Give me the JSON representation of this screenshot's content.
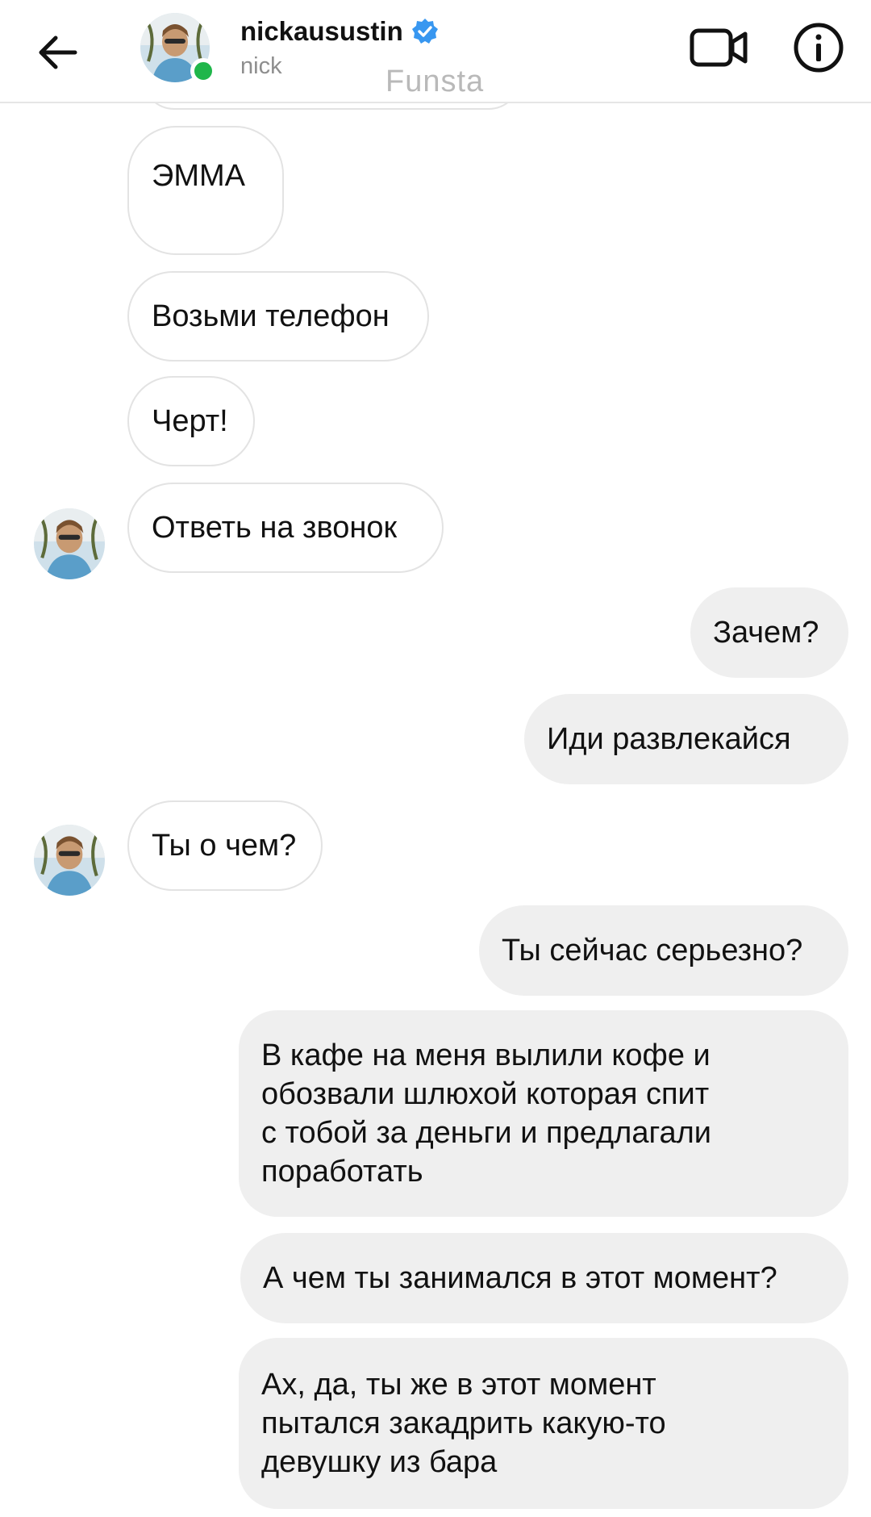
{
  "header": {
    "username": "nickausustin",
    "subname": "nick",
    "watermark": "Funsta",
    "icons": {
      "back": "back-arrow-icon",
      "verified": "verified-badge-icon",
      "video": "video-call-icon",
      "info": "info-icon"
    },
    "online_color": "#1fb64a",
    "verified_color": "#3897f0"
  },
  "messages": [
    {
      "id": "m1",
      "from": "them",
      "text": "ЭММА"
    },
    {
      "id": "m2",
      "from": "them",
      "text": "Возьми телефон"
    },
    {
      "id": "m3",
      "from": "them",
      "text": "Черт!"
    },
    {
      "id": "m4",
      "from": "them",
      "text": "Ответь на звонок"
    },
    {
      "id": "m5",
      "from": "me",
      "text": "Зачем?"
    },
    {
      "id": "m6",
      "from": "me",
      "text": "Иди развлекайся"
    },
    {
      "id": "m7",
      "from": "them",
      "text": "Ты о чем?"
    },
    {
      "id": "m8",
      "from": "me",
      "text": "Ты сейчас серьезно?"
    },
    {
      "id": "m9",
      "from": "me",
      "lines": [
        "В кафе на меня вылили кофе и",
        "обозвали шлюхой которая спит",
        "с тобой за деньги и предлагали",
        "поработать"
      ]
    },
    {
      "id": "m10",
      "from": "me",
      "text": "А чем ты занимался в этот момент?"
    },
    {
      "id": "m11",
      "from": "me",
      "lines": [
        "Ах, да, ты же в этот момент",
        "пытался закадрить какую-то",
        "девушку из бара"
      ]
    }
  ],
  "colors": {
    "incoming_bubble": "#ffffff",
    "outgoing_bubble": "#efefef",
    "bubble_border": "#e3e3e3"
  }
}
